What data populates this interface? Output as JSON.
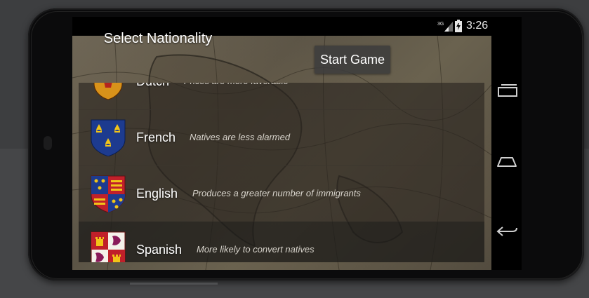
{
  "status_bar": {
    "network": "3G",
    "time": "3:26"
  },
  "app": {
    "title": "Select Nationality",
    "start_button": "Start Game",
    "nationalities": [
      {
        "name": "Dutch",
        "description": "Prices are more favorable",
        "crest_icon": "dutch-crest-icon"
      },
      {
        "name": "French",
        "description": "Natives are less alarmed",
        "crest_icon": "french-crest-icon"
      },
      {
        "name": "English",
        "description": "Produces a greater number of immigrants",
        "crest_icon": "english-crest-icon"
      },
      {
        "name": "Spanish",
        "description": "More likely to convert natives",
        "crest_icon": "spanish-crest-icon"
      }
    ]
  },
  "nav_bar": {
    "icons": [
      "recent-apps-icon",
      "home-icon",
      "back-icon"
    ]
  },
  "colors": {
    "bezel": "#0b0b0c",
    "list_row": "#28241e",
    "text": "#ffffff",
    "desc_text": "#d8d4cc",
    "french_blue": "#1d3b8f",
    "gold": "#f2c418",
    "english_red": "#c0202a"
  }
}
